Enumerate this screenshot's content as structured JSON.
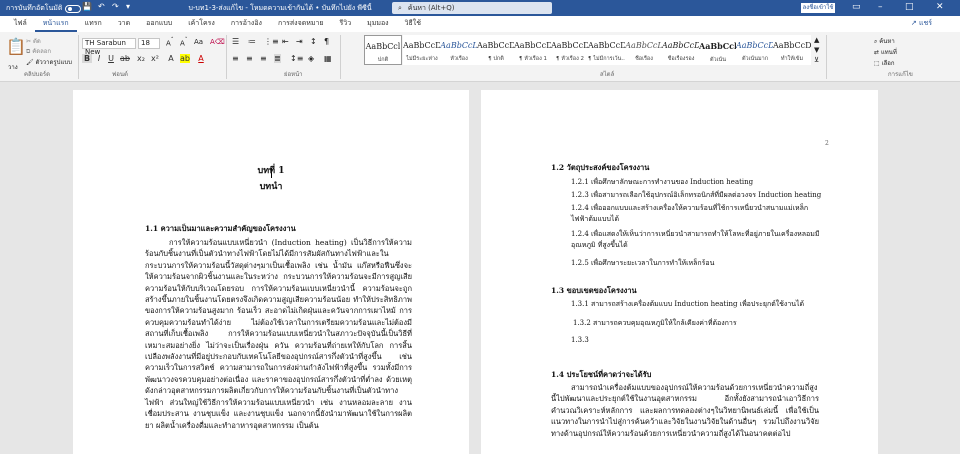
{
  "titlebar": {
    "autosave_label": "การบันทึกอัตโนมัติ",
    "doc_title": "บ-บท1-3-ส่งแก้ไข  -  โหมดความเข้ากันได้  •  บันทึกไปยัง พีซีนี้",
    "search_placeholder": "ค้นหา (Alt+Q)",
    "signin_label": "ลงชื่อเข้าใช้",
    "minimize": "–",
    "maximize": "□",
    "close": "✕",
    "save_icon": "💾",
    "undo_icon": "↶",
    "redo_icon": "↷",
    "customize_icon": "▾"
  },
  "tabs": [
    {
      "label": "ไฟล์"
    },
    {
      "label": "หน้าแรก"
    },
    {
      "label": "แทรก"
    },
    {
      "label": "วาด"
    },
    {
      "label": "ออกแบบ"
    },
    {
      "label": "เค้าโครง"
    },
    {
      "label": "การอ้างอิง"
    },
    {
      "label": "การส่งจดหมาย"
    },
    {
      "label": "รีวิว"
    },
    {
      "label": "มุมมอง"
    },
    {
      "label": "วิธีใช้"
    }
  ],
  "share_label": "แชร์",
  "ribbon": {
    "clipboard": {
      "paste": "วาง",
      "cut": "ตัด",
      "copy": "คัดลอก",
      "painter": "ตัววาดรูปแบบ",
      "label": "คลิปบอร์ด"
    },
    "font": {
      "name": "TH Sarabun New",
      "size": "18",
      "label": "ฟอนต์",
      "bold": "B",
      "italic": "I",
      "underline": "U"
    },
    "paragraph": {
      "label": "ย่อหน้า"
    },
    "styles": {
      "label": "สไตล์",
      "items": [
        {
          "sample": "AaBbCcl",
          "name": "ปกติ"
        },
        {
          "sample": "AaBbCcD",
          "name": "ไม่มีระยะห่าง"
        },
        {
          "sample": "AaBbCcL",
          "name": "หัวเรื่อง"
        },
        {
          "sample": "AaBbCcD",
          "name": "¶ ปกติ"
        },
        {
          "sample": "AaBbCcD",
          "name": "¶ หัวเรื่อง 1"
        },
        {
          "sample": "AaBbCcD",
          "name": "¶ หัวเรื่อง 2"
        },
        {
          "sample": "AaBbCcD",
          "name": "¶ ไม่มีการเว้น..."
        },
        {
          "sample": "AaBbCcL",
          "name": "ชื่อเรื่อง"
        },
        {
          "sample": "AaBbCcD",
          "name": "ชื่อเรื่องรอง"
        },
        {
          "sample": "AaBbCcl",
          "name": "ตัวเน้น"
        },
        {
          "sample": "AaBbCcD",
          "name": "ตัวเน้นมาก"
        },
        {
          "sample": "AaBbCcD",
          "name": "ทำให้เข้ม"
        }
      ]
    },
    "editing": {
      "find": "ค้นหา",
      "replace": "แทนที่",
      "select": "เลือก",
      "label": "การแก้ไข"
    }
  },
  "page1": {
    "chapter_line1": "บทที่ 1",
    "chapter_line2": "บทนำ",
    "heading": "1.1    ความเป็นมาและความสำคัญของโครงงาน",
    "para1": "การให้ความร้อนแบบเหนี่ยวนำ (Induction heating) เป็นวิธีการให้ความร้อนกับชิ้นงานที่เป็นตัวนำทางไฟฟ้าโดยไม่ได้มีการสัมผัสกันทางไฟฟ้าและในกระบวนการให้ความร้อนนี้วัสดุต่างๆมาเป็นเชื้อเพลิง เช่น น้ำมัน แก๊สหรือฟืนซึ่งจะให้ความร้อนจากผิวชิ้นงานและในระหว่าง กระบวนการให้ความร้อนจะมีการสูญเสียความร้อนให้กับบริเวณโดยรอบ การให้ความร้อนแบบเหนี่ยวนำนี้ ความร้อนจะถูกสร้างขึ้นภายในชิ้นงานโดยตรงจึงเกิดความสูญเสียความร้อนน้อย ทำให้ประสิทธิภาพของการให้ความร้อนสูงมาก ร้อนเร็ว สะอาดไม่เกิดฝุ่นและควันจากการเผาไหม้ การควบคุมความร้อนทำได้ง่าย ไม่ต้องใช้เวลาในการเตรียมความร้อนและไม่ต้องมีสถานที่เก็บเชื้อเพลิง การให้ความร้อนแบบเหนี่ยวนำในสภาวะปัจจุบันนี้เป็นวิธีที่เหมาะสมอย่างยิ่ง ไม่ว่าจะเป็นเรื่องฝุ่น ควัน ความร้อนที่ถ่ายเทให้กับโลก การสิ้นเปลืองพลังงานที่มีอยู่ประกอบกับเทคโนโลยีของอุปกรณ์สารกึ่งตัวนำที่สูงขึ้น เช่น ความเร็วในการสวิตช์ ความสามารถในการส่งผ่านกำลังไฟฟ้าที่สูงขึ้น รวมทั้งมีการพัฒนาวงจรควบคุมอย่างต่อเนื่อง และราคาของอุปกรณ์สารกึ่งตัวนำที่ต่ำลง ด้วยเหตุดังกล่าวอุตสาหกรรมการผลิตเกี่ยวกับการให้ความร้อนกับชิ้นงานที่เป็นตัวนำทางไฟฟ้า ส่วนใหญ่ใช้วิธีการให้ความร้อนแบบเหนี่ยวนำ เช่น งานหลอมละลาย งานเชื่อมประสาน งานชุบแข็ง และงานชุบแข็ง นอกจากนี้ยังนำมาพัฒนาใช้ในการผลิตยา ผลิตน้ำเครื่องดื่มและทำอาหารอุตสาหกรรม เป็นต้น"
  },
  "page2": {
    "page_number": "2",
    "h12": "1.2    วัตถุประสงค์ของโครงงาน",
    "items12": [
      "1.2.1    เพื่อศึกษาลักษณะการทำงานของ Induction heating",
      "1.2.3    เพื่อสามารถเลือกใช้อุปกรณ์อิเล็กทรอนิกส์ที่มีผลต่อวงจร Induction heating",
      "1.2.4    เพื่อออกแบบและสร้างเครื่องให้ความร้อนที่ใช้การเหนี่ยวนำสนามแม่เหล็กไฟฟ้าต้มแบบได้",
      "1.2.4    เพื่อแสดงให้เห็นว่าการเหนี่ยวนำสามารถทำให้โลหะที่อยู่ภายในเครื่องหลอมมีอุณหภูมิ                                          ที่สูงขึ้นได้",
      "1.2.5    เพื่อศึกษาระยะเวลาในการทำให้เหล็กร้อน"
    ],
    "h13": "1.3    ขอบเขตของโครงงาน",
    "items13": [
      "1.3.1 สามารถสร้างเครื่องต้มแบบ Induction heating เพื่อประยุกต์ใช้งานได้",
      "1.3.2 สามารถควบคุมอุณหภูมิให้ใกล้เคียงค่าที่ต้องการ",
      "1.3.3"
    ],
    "h14": "1.4    ประโยชน์ที่คาดว่าจะได้รับ",
    "para14": "สามารถนำเครื่องต้มแบบของอุปกรณ์ให้ความร้อนด้วยการเหนี่ยวนำความถี่สูงนี้ไปพัฒนาและประยุกต์ใช้ในงานอุตสาหกรรม อีกทั้งยังสามารถนำเอาวิธีการคำนวณวิเคราะห์หลักการ และผลการทดลองต่างๆในวิทยานิพนธ์เล่มนี้ เพื่อใช้เป็นแนวทางในการนำไปสู่การค้นคว้าและวิจัยในงานวิจัยในด้านอื่นๆ รวมไปถึงงานวิจัยทางด้านอุปกรณ์ให้ความร้อนด้วยการเหนี่ยวนำความถี่สูงได้ในอนาคตต่อไป"
  }
}
